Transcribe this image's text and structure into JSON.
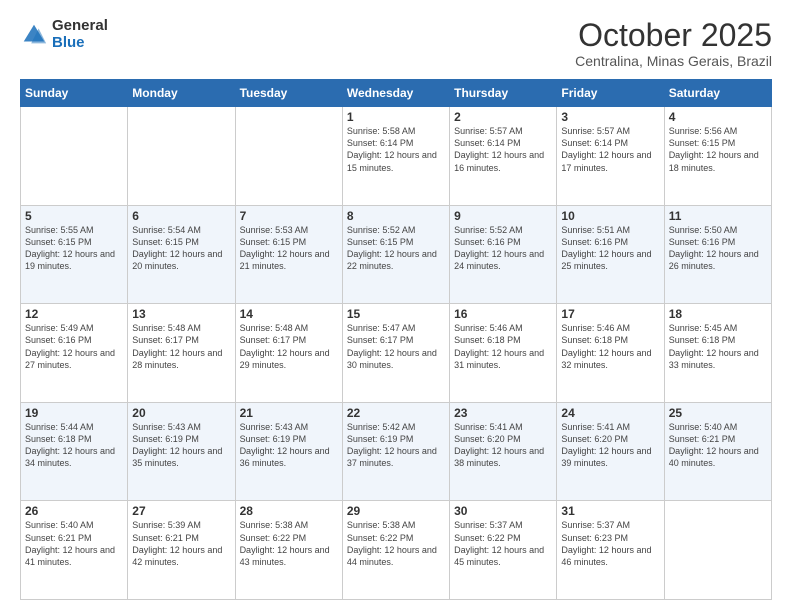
{
  "header": {
    "logo_general": "General",
    "logo_blue": "Blue",
    "month_title": "October 2025",
    "location": "Centralina, Minas Gerais, Brazil"
  },
  "weekdays": [
    "Sunday",
    "Monday",
    "Tuesday",
    "Wednesday",
    "Thursday",
    "Friday",
    "Saturday"
  ],
  "weeks": [
    [
      {
        "day": "",
        "info": ""
      },
      {
        "day": "",
        "info": ""
      },
      {
        "day": "",
        "info": ""
      },
      {
        "day": "1",
        "info": "Sunrise: 5:58 AM\nSunset: 6:14 PM\nDaylight: 12 hours and 15 minutes."
      },
      {
        "day": "2",
        "info": "Sunrise: 5:57 AM\nSunset: 6:14 PM\nDaylight: 12 hours and 16 minutes."
      },
      {
        "day": "3",
        "info": "Sunrise: 5:57 AM\nSunset: 6:14 PM\nDaylight: 12 hours and 17 minutes."
      },
      {
        "day": "4",
        "info": "Sunrise: 5:56 AM\nSunset: 6:15 PM\nDaylight: 12 hours and 18 minutes."
      }
    ],
    [
      {
        "day": "5",
        "info": "Sunrise: 5:55 AM\nSunset: 6:15 PM\nDaylight: 12 hours and 19 minutes."
      },
      {
        "day": "6",
        "info": "Sunrise: 5:54 AM\nSunset: 6:15 PM\nDaylight: 12 hours and 20 minutes."
      },
      {
        "day": "7",
        "info": "Sunrise: 5:53 AM\nSunset: 6:15 PM\nDaylight: 12 hours and 21 minutes."
      },
      {
        "day": "8",
        "info": "Sunrise: 5:52 AM\nSunset: 6:15 PM\nDaylight: 12 hours and 22 minutes."
      },
      {
        "day": "9",
        "info": "Sunrise: 5:52 AM\nSunset: 6:16 PM\nDaylight: 12 hours and 24 minutes."
      },
      {
        "day": "10",
        "info": "Sunrise: 5:51 AM\nSunset: 6:16 PM\nDaylight: 12 hours and 25 minutes."
      },
      {
        "day": "11",
        "info": "Sunrise: 5:50 AM\nSunset: 6:16 PM\nDaylight: 12 hours and 26 minutes."
      }
    ],
    [
      {
        "day": "12",
        "info": "Sunrise: 5:49 AM\nSunset: 6:16 PM\nDaylight: 12 hours and 27 minutes."
      },
      {
        "day": "13",
        "info": "Sunrise: 5:48 AM\nSunset: 6:17 PM\nDaylight: 12 hours and 28 minutes."
      },
      {
        "day": "14",
        "info": "Sunrise: 5:48 AM\nSunset: 6:17 PM\nDaylight: 12 hours and 29 minutes."
      },
      {
        "day": "15",
        "info": "Sunrise: 5:47 AM\nSunset: 6:17 PM\nDaylight: 12 hours and 30 minutes."
      },
      {
        "day": "16",
        "info": "Sunrise: 5:46 AM\nSunset: 6:18 PM\nDaylight: 12 hours and 31 minutes."
      },
      {
        "day": "17",
        "info": "Sunrise: 5:46 AM\nSunset: 6:18 PM\nDaylight: 12 hours and 32 minutes."
      },
      {
        "day": "18",
        "info": "Sunrise: 5:45 AM\nSunset: 6:18 PM\nDaylight: 12 hours and 33 minutes."
      }
    ],
    [
      {
        "day": "19",
        "info": "Sunrise: 5:44 AM\nSunset: 6:18 PM\nDaylight: 12 hours and 34 minutes."
      },
      {
        "day": "20",
        "info": "Sunrise: 5:43 AM\nSunset: 6:19 PM\nDaylight: 12 hours and 35 minutes."
      },
      {
        "day": "21",
        "info": "Sunrise: 5:43 AM\nSunset: 6:19 PM\nDaylight: 12 hours and 36 minutes."
      },
      {
        "day": "22",
        "info": "Sunrise: 5:42 AM\nSunset: 6:19 PM\nDaylight: 12 hours and 37 minutes."
      },
      {
        "day": "23",
        "info": "Sunrise: 5:41 AM\nSunset: 6:20 PM\nDaylight: 12 hours and 38 minutes."
      },
      {
        "day": "24",
        "info": "Sunrise: 5:41 AM\nSunset: 6:20 PM\nDaylight: 12 hours and 39 minutes."
      },
      {
        "day": "25",
        "info": "Sunrise: 5:40 AM\nSunset: 6:21 PM\nDaylight: 12 hours and 40 minutes."
      }
    ],
    [
      {
        "day": "26",
        "info": "Sunrise: 5:40 AM\nSunset: 6:21 PM\nDaylight: 12 hours and 41 minutes."
      },
      {
        "day": "27",
        "info": "Sunrise: 5:39 AM\nSunset: 6:21 PM\nDaylight: 12 hours and 42 minutes."
      },
      {
        "day": "28",
        "info": "Sunrise: 5:38 AM\nSunset: 6:22 PM\nDaylight: 12 hours and 43 minutes."
      },
      {
        "day": "29",
        "info": "Sunrise: 5:38 AM\nSunset: 6:22 PM\nDaylight: 12 hours and 44 minutes."
      },
      {
        "day": "30",
        "info": "Sunrise: 5:37 AM\nSunset: 6:22 PM\nDaylight: 12 hours and 45 minutes."
      },
      {
        "day": "31",
        "info": "Sunrise: 5:37 AM\nSunset: 6:23 PM\nDaylight: 12 hours and 46 minutes."
      },
      {
        "day": "",
        "info": ""
      }
    ]
  ]
}
